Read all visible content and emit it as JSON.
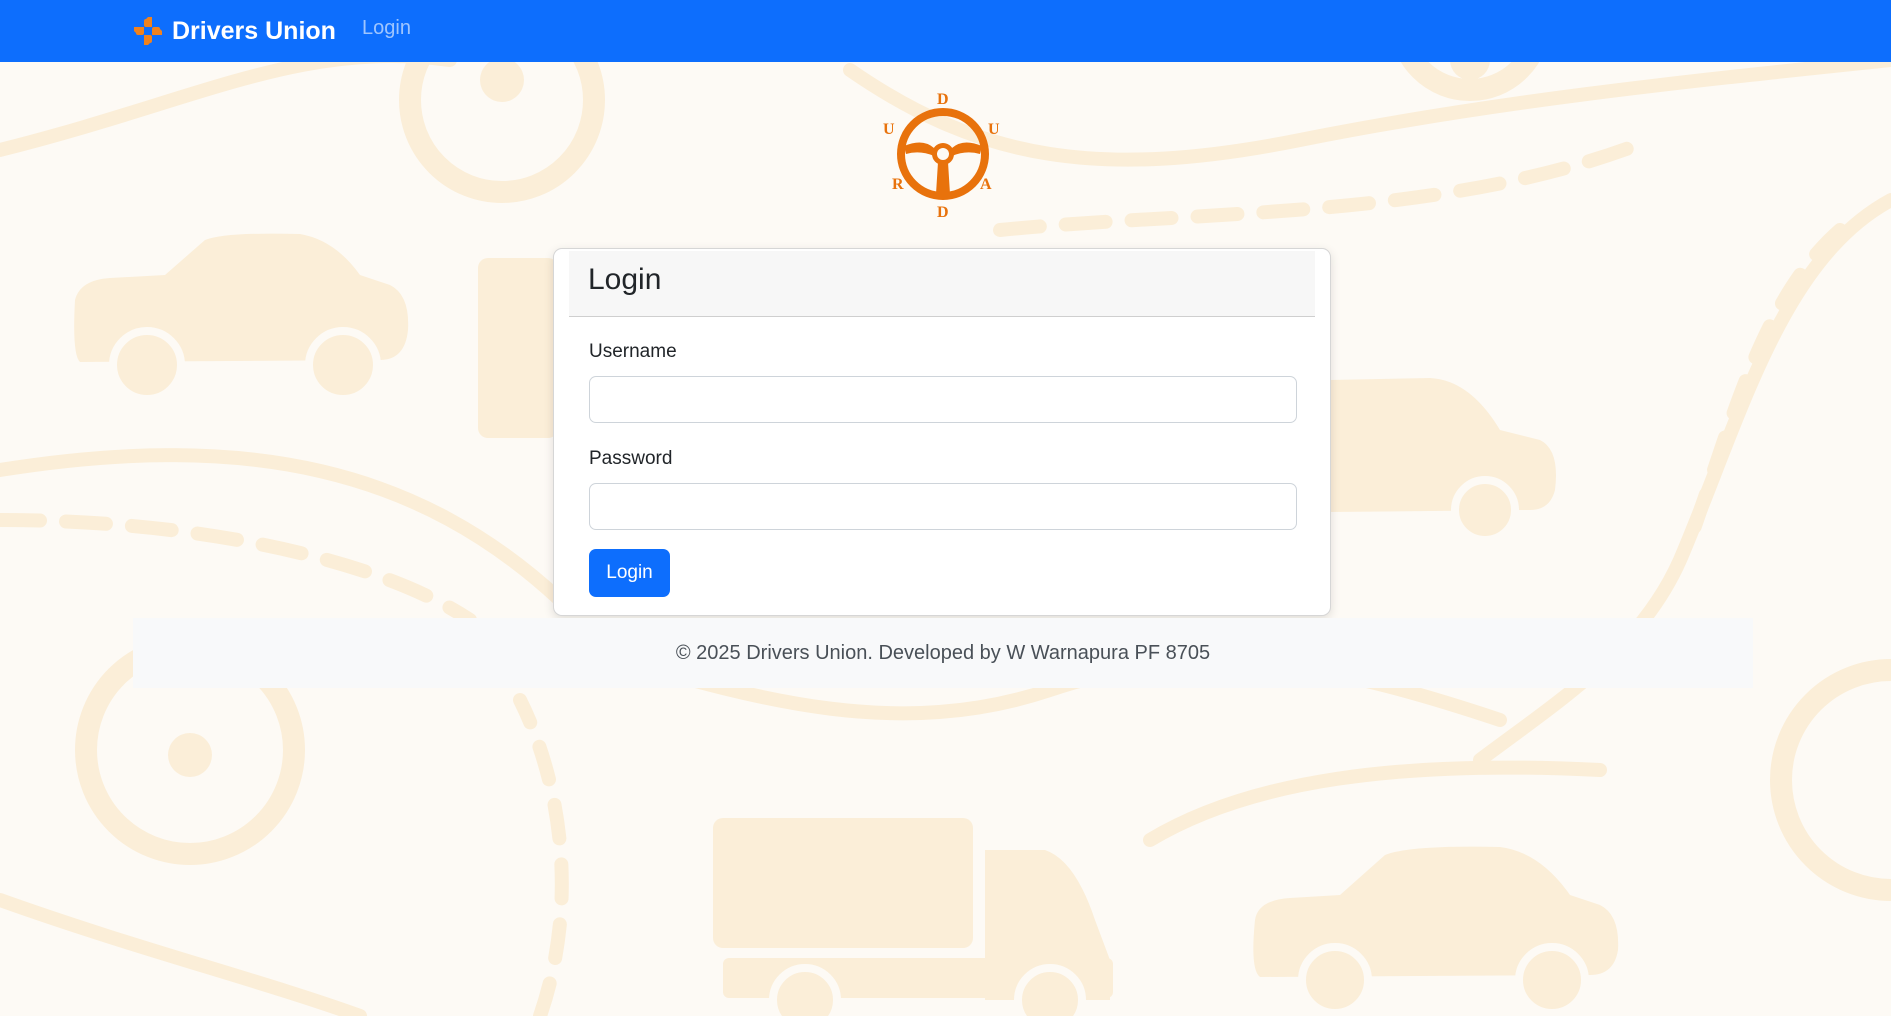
{
  "navbar": {
    "brand": "Drivers Union",
    "brand_icon": "four-arm-orange-logo-icon",
    "links": [
      "Login"
    ]
  },
  "logo": {
    "letters": [
      "D",
      "U",
      "U",
      "R",
      "A",
      "D"
    ],
    "icon": "steering-wheel-icon"
  },
  "login_card": {
    "title": "Login",
    "username_label": "Username",
    "username_value": "",
    "password_label": "Password",
    "password_value": "",
    "submit_label": "Login"
  },
  "footer": {
    "text": "© 2025 Drivers Union. Developed by W Warnapura PF 8705"
  },
  "colors": {
    "navbar": "#0d6efd",
    "accent_orange": "#e8720c",
    "button": "#0d6efd",
    "page_background": "#fdfaf5",
    "watermark": "#fbeed9"
  }
}
